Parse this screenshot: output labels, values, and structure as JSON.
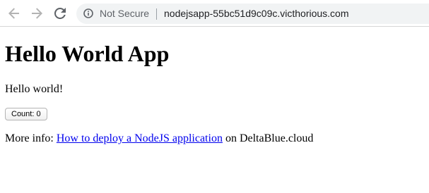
{
  "browser": {
    "security_label": "Not Secure",
    "url": "nodejsapp-55bc51d9c09c.victhorious.com",
    "icons": {
      "back": "arrow-left-icon",
      "forward": "arrow-right-icon",
      "reload": "reload-icon",
      "info": "info-circle-icon"
    },
    "colors": {
      "icon_gray": "#5f6368",
      "omnibox_bg": "#f1f3f4"
    }
  },
  "page": {
    "title": "Hello World App",
    "greeting": "Hello world!",
    "counter_button_label": "Count: 0",
    "more_info_prefix": "More info:",
    "link_text": "How to deploy a NodeJS application",
    "more_info_suffix": "on DeltaBlue.cloud",
    "colors": {
      "link": "#0000ee",
      "text": "#000000"
    }
  }
}
